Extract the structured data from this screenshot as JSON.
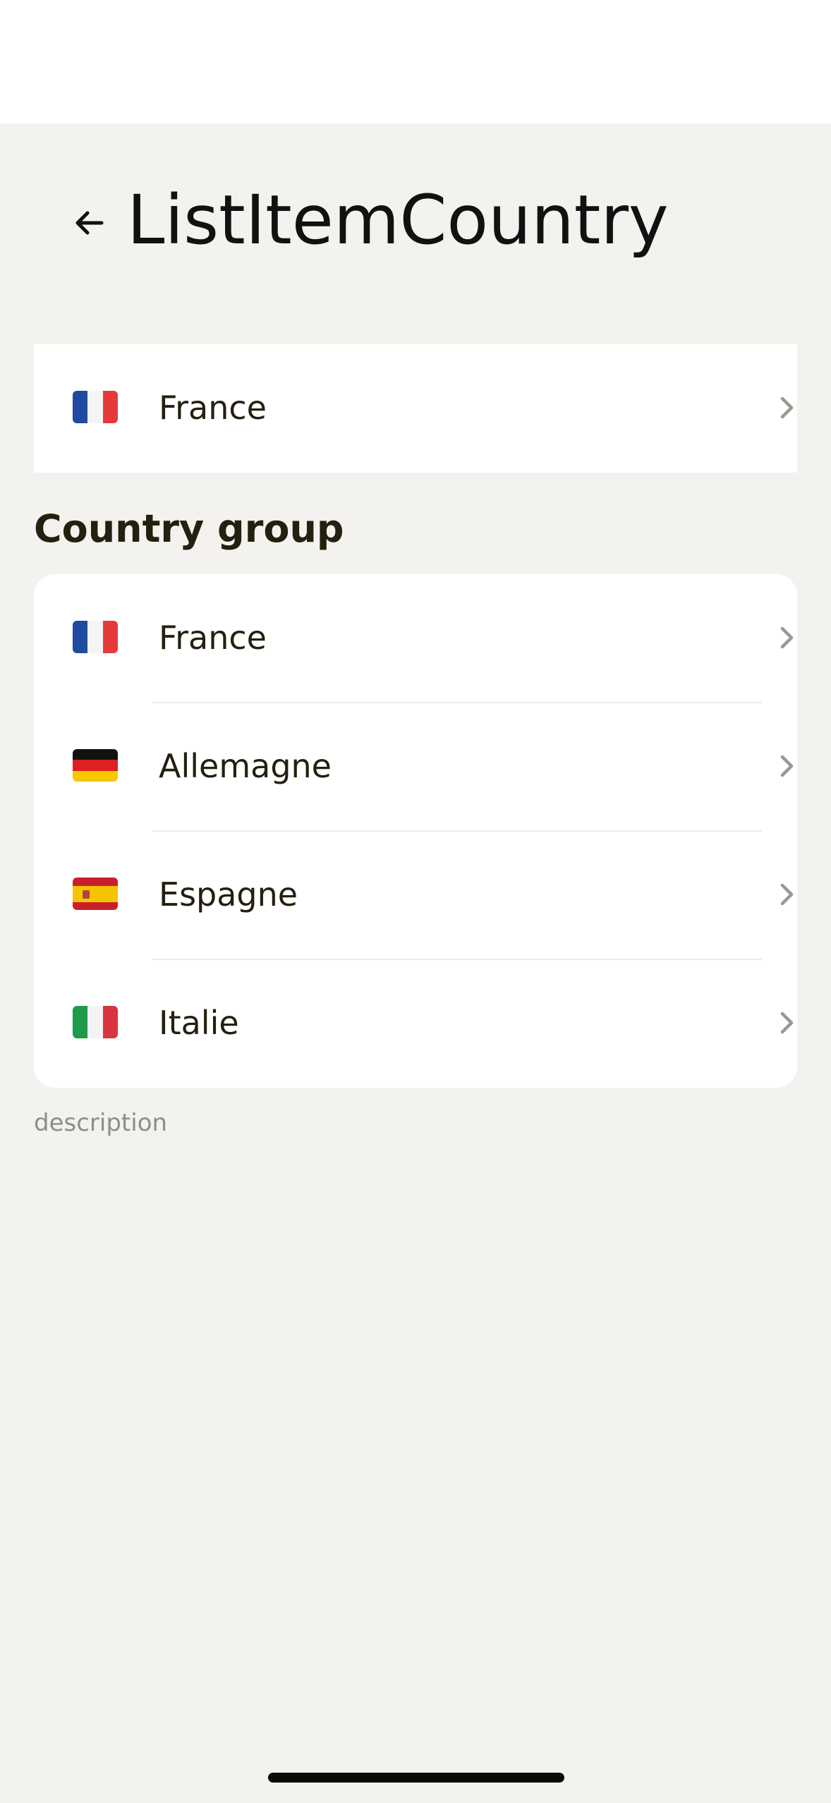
{
  "header": {
    "title": "ListItemCountry"
  },
  "single_item": {
    "flag": "flag-france-icon",
    "label": "France"
  },
  "country_group": {
    "title": "Country group",
    "items": [
      {
        "flag": "flag-france-icon",
        "label": "France"
      },
      {
        "flag": "flag-germany-icon",
        "label": "Allemagne"
      },
      {
        "flag": "flag-spain-icon",
        "label": "Espagne"
      },
      {
        "flag": "flag-italy-icon",
        "label": "Italie"
      }
    ],
    "description": "description"
  },
  "colors": {
    "background": "#f3f2ef",
    "card": "#ffffff",
    "text": "#241f0e",
    "chevron": "#9a9893",
    "description": "#8f8d88"
  }
}
